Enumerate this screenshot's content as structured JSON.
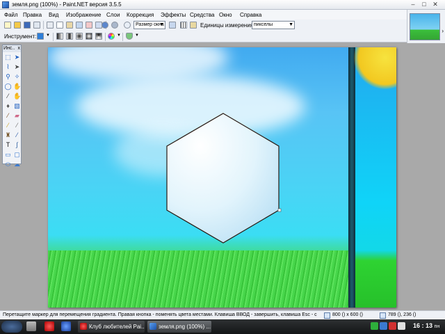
{
  "window": {
    "title": "земля.png (100%) - Paint.NET версия 3.5.5",
    "minimize": "–",
    "maximize": "□",
    "close": "✕"
  },
  "menu": [
    "Файл",
    "Правка",
    "Вид",
    "Изображение",
    "Слои",
    "Коррекция",
    "Эффекты",
    "Средства",
    "Окно",
    "Справка"
  ],
  "toolbar": {
    "zoom_value": "Размер окна",
    "units_label": "Единицы измерения:",
    "units_value": "пикселы",
    "tool_label": "Инструмент:"
  },
  "tools_window": {
    "title": "Инс..",
    "close": "x"
  },
  "tools": [
    {
      "name": "rectangle-select-icon",
      "glyph": "⬚",
      "color": "#1f5fbf"
    },
    {
      "name": "move-selection-icon",
      "glyph": "➤",
      "color": "#1f5fbf"
    },
    {
      "name": "lasso-select-icon",
      "glyph": "⌇",
      "color": "#1f5fbf"
    },
    {
      "name": "move-selected-icon",
      "glyph": "➤",
      "color": "#444"
    },
    {
      "name": "zoom-icon",
      "glyph": "⚲",
      "color": "#1f5fbf"
    },
    {
      "name": "magic-wand-select-icon",
      "glyph": "✧",
      "color": "#1f5fbf"
    },
    {
      "name": "ellipse-select-icon",
      "glyph": "◯",
      "color": "#1f5fbf"
    },
    {
      "name": "pan-icon",
      "glyph": "✋",
      "color": "#c07020"
    },
    {
      "name": "magic-wand-icon",
      "glyph": "⁄",
      "color": "#333"
    },
    {
      "name": "hand-icon",
      "glyph": "✋",
      "color": "#d08030"
    },
    {
      "name": "paint-bucket-icon",
      "glyph": "♦",
      "color": "#555"
    },
    {
      "name": "gradient-icon",
      "glyph": "▧",
      "color": "#1f5fbf"
    },
    {
      "name": "paintbrush-icon",
      "glyph": "⁄",
      "color": "#7a4a20"
    },
    {
      "name": "eraser-icon",
      "glyph": "▰",
      "color": "#d06a8a"
    },
    {
      "name": "pencil-icon",
      "glyph": "⁄",
      "color": "#c8a020"
    },
    {
      "name": "color-picker-icon",
      "glyph": "⁄",
      "color": "#6a6a6a"
    },
    {
      "name": "clone-stamp-icon",
      "glyph": "♜",
      "color": "#7a5a30"
    },
    {
      "name": "recolor-icon",
      "glyph": "⁄",
      "color": "#2050a0"
    },
    {
      "name": "text-icon",
      "glyph": "T",
      "color": "#111"
    },
    {
      "name": "line-curve-icon",
      "glyph": "∫",
      "color": "#3060a0"
    },
    {
      "name": "rectangle-shape-icon",
      "glyph": "▭",
      "color": "#3a7ad0"
    },
    {
      "name": "rounded-rectangle-icon",
      "glyph": "▢",
      "color": "#3a7ad0"
    },
    {
      "name": "ellipse-shape-icon",
      "glyph": "⬭",
      "color": "#3a7ad0"
    },
    {
      "name": "freeform-shape-icon",
      "glyph": "☁",
      "color": "#3a7ad0"
    }
  ],
  "status": {
    "hint": "Перетащите маркер для перемещения градиента. Правая кнопка - поменять цвета местами. Клавиша ВВОД - завершить, клавиша Esc - с",
    "size": "800 () x 600 ()",
    "position": "789 (), 236 ()"
  },
  "taskbar": {
    "tasks": [
      "Клуб любителей Pai...",
      "земля.png (100%) ..."
    ],
    "clock": "16 : 13",
    "clock_suffix": "пн"
  }
}
